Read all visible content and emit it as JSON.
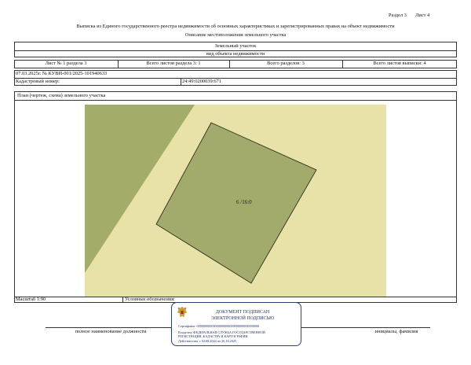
{
  "header": {
    "section": "Раздел 3",
    "sheet": "Лист 4",
    "title": "Выписка из Единого государственного реестра недвижимости об основных характеристиках и зарегистрированных правах на объект недвижимости",
    "subtitle": "Описание местоположения земельного участка"
  },
  "object": {
    "type": "Земельный участок",
    "type_caption": "вид объекта недвижимости"
  },
  "sheet_info": {
    "sheet_of_section": "Лист № 1 раздела 3",
    "sheets_in_section": "Всего листов раздела 3: 1",
    "sections_total": "Всего разделов: 3",
    "sheets_total": "Всего листов выписки: 4"
  },
  "record": {
    "date_number": "07.03.2025г. № КУВИ-001/2025-101940633",
    "cadastral_label": "Кадастровый номер:",
    "cadastral_value": "24:49:0200039:671"
  },
  "plan": {
    "label": "План (чертеж, схема) земельного участка",
    "parcel_label": "6 /16:0",
    "colors": {
      "background": "#e8e2a8",
      "strip": "#a4ac6c",
      "parcel": "#a2ab6c",
      "outline": "#2f2f24"
    }
  },
  "footer": {
    "scale": "Масштаб 1:90",
    "legend": "Условные обозначения:",
    "position_caption": "полное наименование должности",
    "name_caption": "инициалы, фамилия"
  },
  "stamp": {
    "emblem": "emblem-icon",
    "line1": "ДОКУМЕНТ ПОДПИСАН",
    "line2": "ЭЛЕКТРОННОЙ ПОДПИСЬЮ",
    "cert": "Сертификат: 00000000000000000000000000000000000000",
    "owner": "Владелец: ФЕДЕРАЛЬНАЯ СЛУЖБА ГОСУДАРСТВЕННОЙ",
    "owner2": "РЕГИСТРАЦИИ, КАДАСТРА И КАРТОГРАФИИ",
    "valid": "Действителен: с 02.08.2024 по 26.10.2025"
  }
}
